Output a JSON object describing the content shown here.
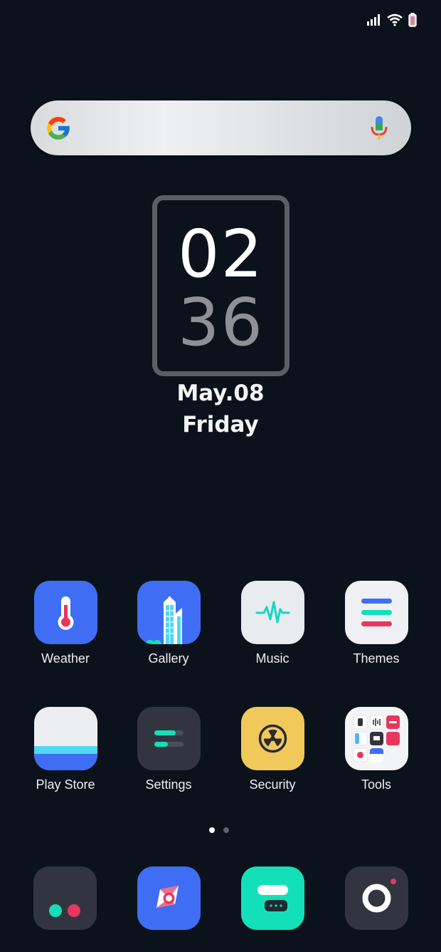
{
  "status_bar": {
    "icons": [
      "signal-icon",
      "wifi-icon",
      "battery-icon"
    ]
  },
  "search": {
    "logo": "google-logo-icon",
    "mic": "microphone-icon"
  },
  "clock": {
    "hour": "02",
    "minute": "36",
    "date": "May.08",
    "day": "Friday"
  },
  "apps": [
    {
      "label": "Weather",
      "icon": "thermometer-icon",
      "color": "#3f6ef5"
    },
    {
      "label": "Gallery",
      "icon": "buildings-icon",
      "color": "#3f6ef5"
    },
    {
      "label": "Music",
      "icon": "waveform-icon",
      "color": "#e8ecef"
    },
    {
      "label": "Themes",
      "icon": "stripes-icon",
      "color": "#eef0f3"
    },
    {
      "label": "Play Store",
      "icon": "store-icon",
      "color": "#eceef1"
    },
    {
      "label": "Settings",
      "icon": "toggles-icon",
      "color": "#32353f"
    },
    {
      "label": "Security",
      "icon": "radiation-icon",
      "color": "#f0c95a"
    },
    {
      "label": "Tools",
      "icon": "tools-folder-icon",
      "color": "#f3f4f6"
    }
  ],
  "page_indicator": {
    "count": 2,
    "active": 1,
    "active_color": "#ffffff",
    "inactive_color": "#5c6168"
  },
  "dock": [
    {
      "icon": "two-dots-icon",
      "color": "#32353f"
    },
    {
      "icon": "compass-icon",
      "color": "#3f6ef5"
    },
    {
      "icon": "message-icon",
      "color": "#13e0b8"
    },
    {
      "icon": "camera-icon",
      "color": "#32353f"
    }
  ]
}
